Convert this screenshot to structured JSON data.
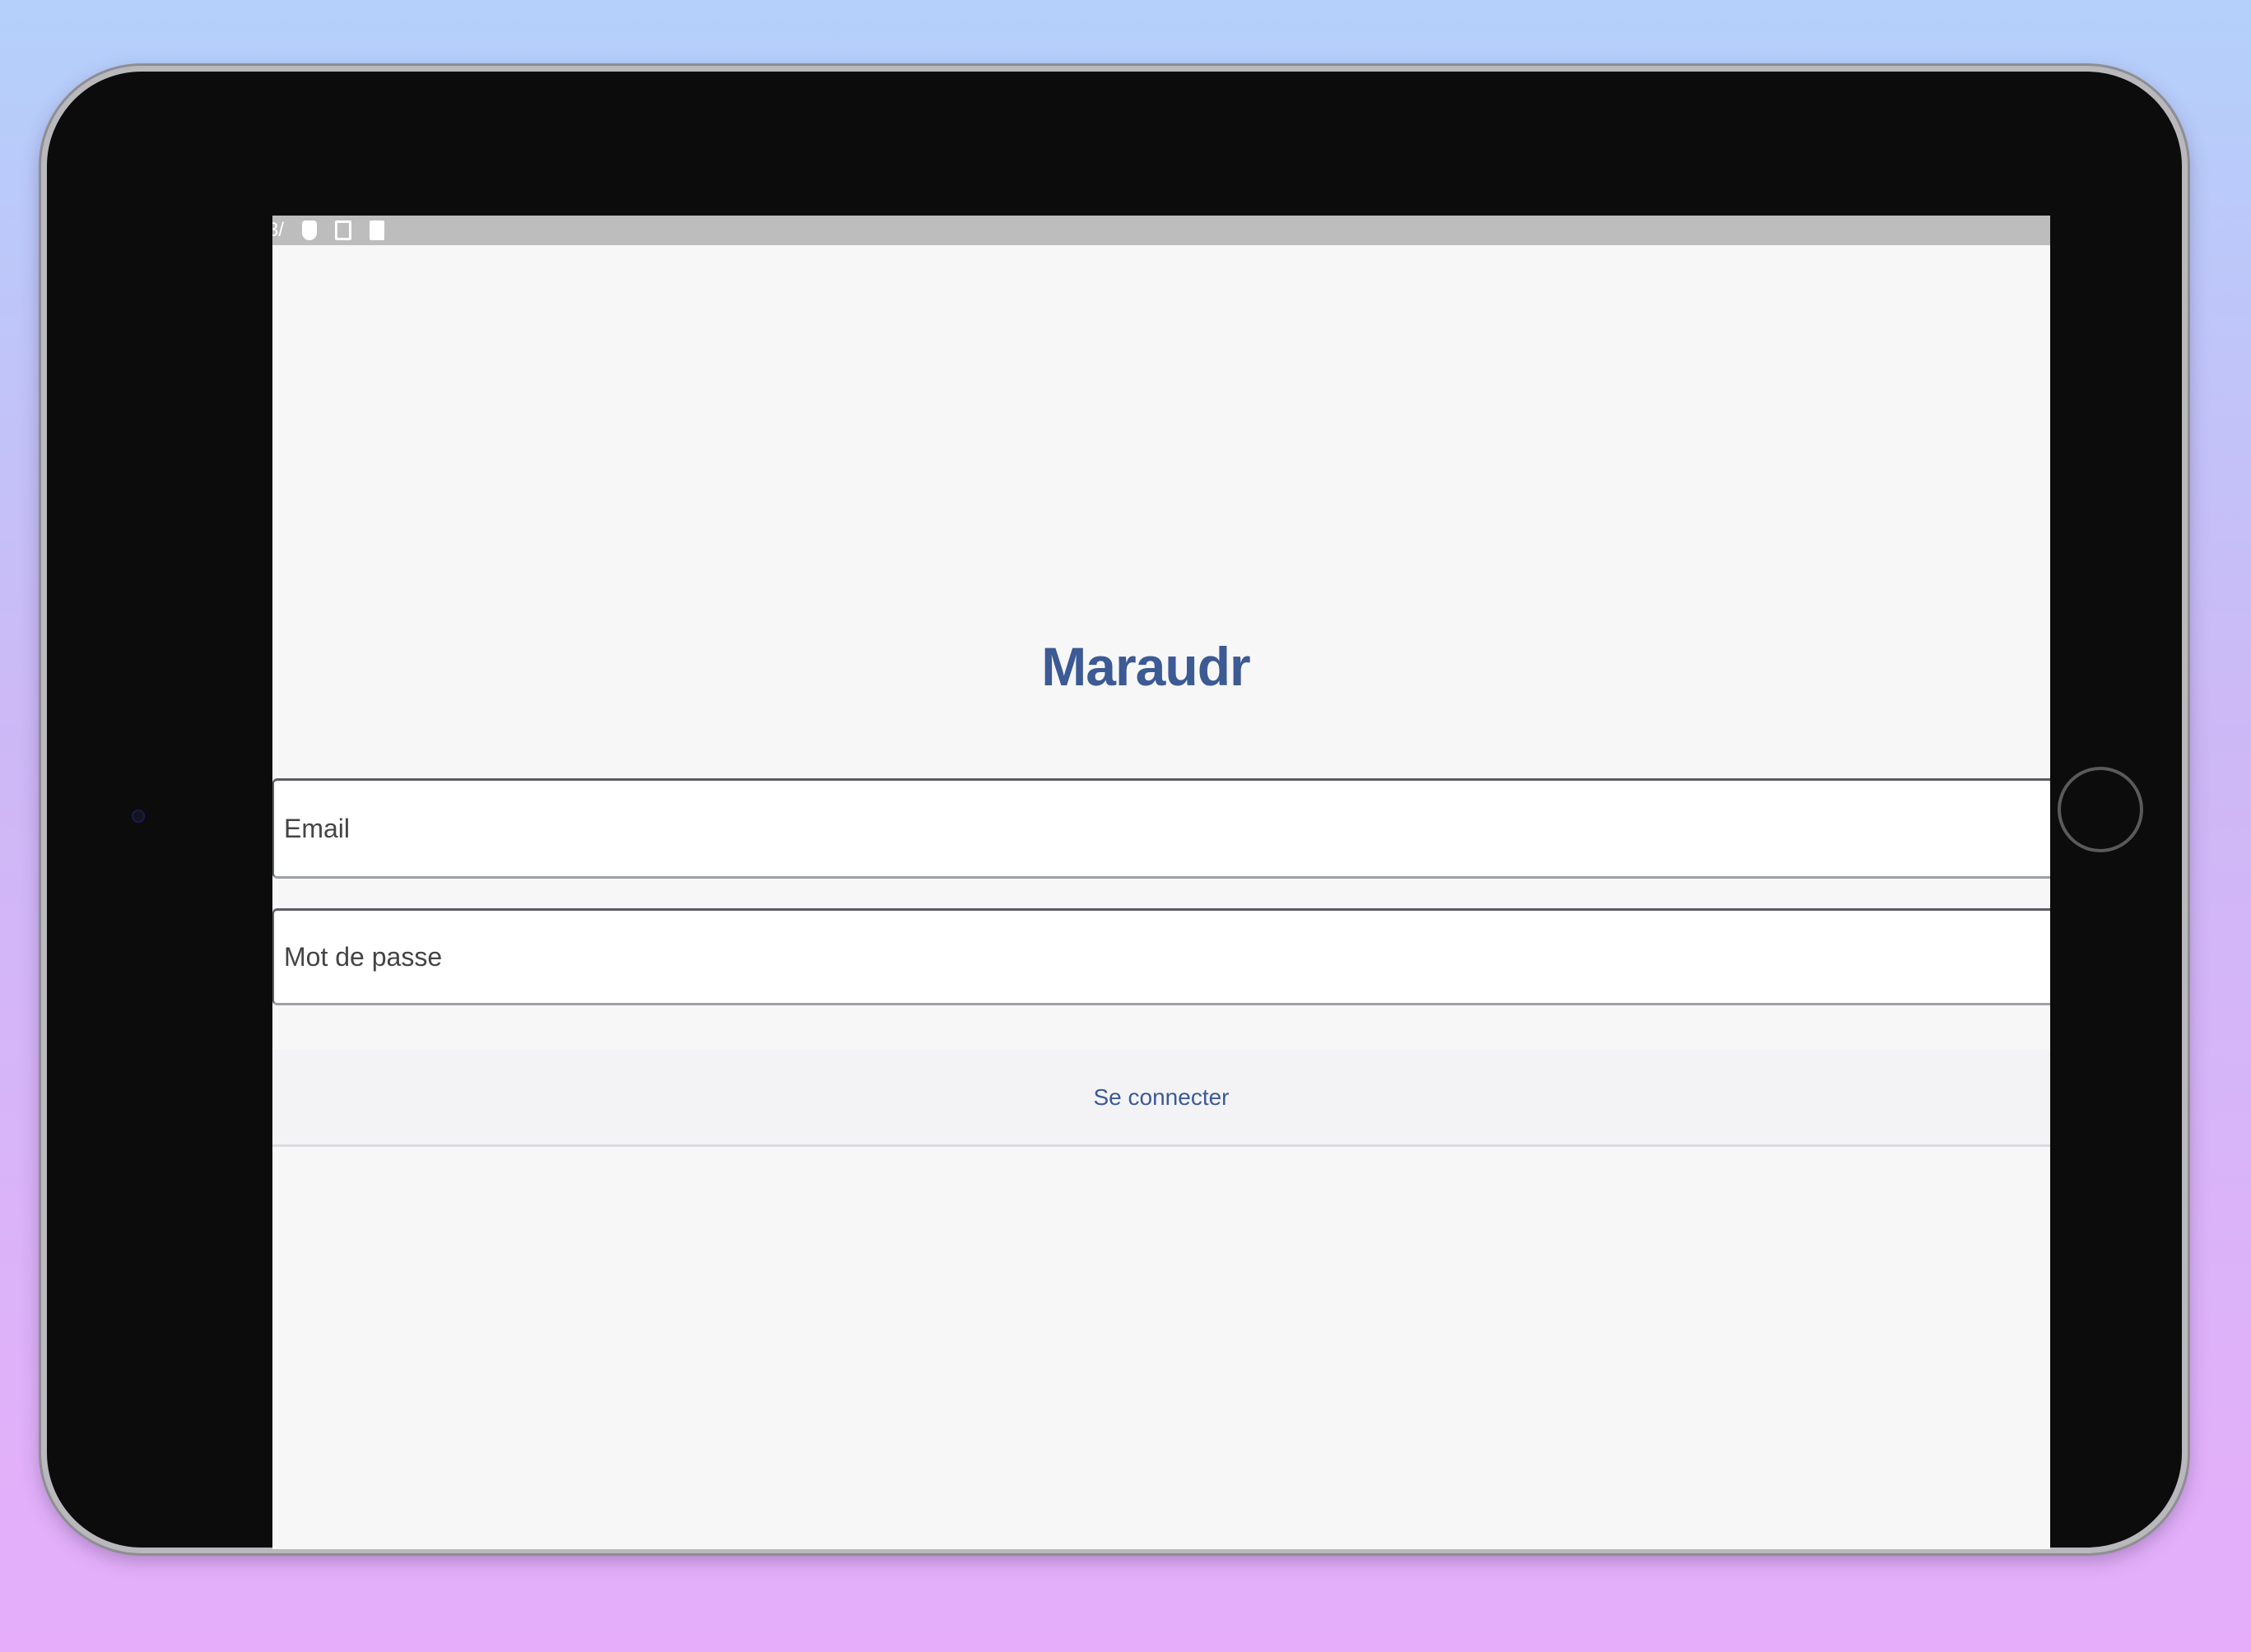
{
  "device": {
    "type": "tablet"
  },
  "status_bar": {
    "time_fragment": "3/",
    "icons": [
      "shield-icon",
      "sim-card-icon",
      "battery-icon"
    ]
  },
  "app": {
    "title": "Maraudr"
  },
  "login_form": {
    "email": {
      "placeholder": "Email",
      "value": ""
    },
    "password": {
      "placeholder": "Mot de passe",
      "value": ""
    },
    "submit_label": "Se connecter"
  },
  "colors": {
    "accent": "#3c5a94",
    "background_top": "#b4d0fb",
    "background_bottom": "#e6aefa",
    "screen": "#f7f7f7",
    "bezel": "#0c0c0c",
    "status_bar": "#bdbdbd"
  }
}
